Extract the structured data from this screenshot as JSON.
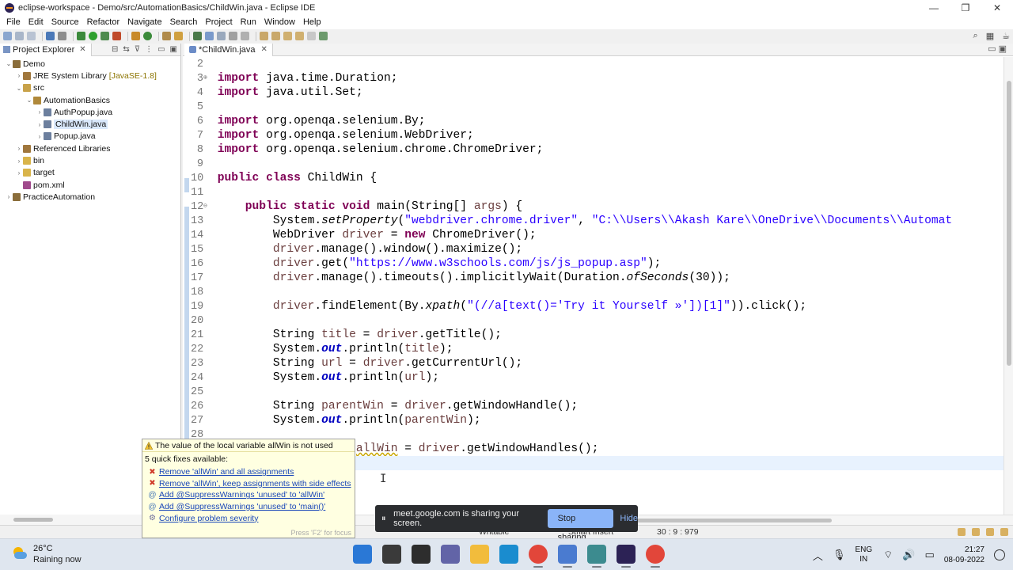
{
  "window": {
    "title": "eclipse-workspace - Demo/src/AutomationBasics/ChildWin.java - Eclipse IDE",
    "min_glyph": "—",
    "max_glyph": "❐",
    "close_glyph": "✕"
  },
  "menu": [
    "File",
    "Edit",
    "Source",
    "Refactor",
    "Navigate",
    "Search",
    "Project",
    "Run",
    "Window",
    "Help"
  ],
  "toolbar": {
    "search_glyph": "⌕",
    "perspective_glyph": "▦",
    "java_perspective_glyph": "☕"
  },
  "explorer": {
    "tab_label": "Project Explorer",
    "close_glyph": "✕",
    "tree": [
      {
        "label": "Demo",
        "indent": 0,
        "chev": "⌄",
        "icon": "project-icon",
        "color": "#8a6d3b"
      },
      {
        "label": "JRE System Library",
        "suffix": "[JavaSE-1.8]",
        "indent": 1,
        "chev": "›",
        "icon": "library-icon",
        "color": "#a0773d"
      },
      {
        "label": "src",
        "indent": 1,
        "chev": "⌄",
        "icon": "source-folder-icon",
        "color": "#c8a24a"
      },
      {
        "label": "AutomationBasics",
        "indent": 2,
        "chev": "⌄",
        "icon": "package-icon",
        "color": "#b0893a"
      },
      {
        "label": "AuthPopup.java",
        "indent": 3,
        "chev": "›",
        "icon": "java-file-icon",
        "color": "#6c7f9e"
      },
      {
        "label": "ChildWin.java",
        "indent": 3,
        "chev": "›",
        "icon": "java-file-icon",
        "color": "#6c7f9e",
        "selected": true
      },
      {
        "label": "Popup.java",
        "indent": 3,
        "chev": "›",
        "icon": "java-file-icon",
        "color": "#6c7f9e"
      },
      {
        "label": "Referenced Libraries",
        "indent": 1,
        "chev": "›",
        "icon": "library-icon",
        "color": "#a0773d"
      },
      {
        "label": "bin",
        "indent": 1,
        "chev": "›",
        "icon": "folder-icon",
        "color": "#d9b44a"
      },
      {
        "label": "target",
        "indent": 1,
        "chev": "›",
        "icon": "folder-icon",
        "color": "#d9b44a"
      },
      {
        "label": "pom.xml",
        "indent": 1,
        "chev": "",
        "icon": "xml-file-icon",
        "color": "#a04a8c"
      },
      {
        "label": "PracticeAutomation",
        "indent": 0,
        "chev": "›",
        "icon": "project-icon",
        "color": "#8a6d3b"
      }
    ]
  },
  "editor": {
    "tab_label": "*ChildWin.java",
    "close_glyph": "✕",
    "minimize_glyph": "▭",
    "maximize_glyph": "▣",
    "current_line": 30,
    "lines": [
      {
        "n": "2",
        "fold": "",
        "html": ""
      },
      {
        "n": "3",
        "fold": "⊕",
        "html": "<span class=\"kw\">import</span> java.time.Duration;"
      },
      {
        "n": "4",
        "fold": "",
        "html": "<span class=\"kw\">import</span> java.util.Set;"
      },
      {
        "n": "5",
        "fold": "",
        "html": ""
      },
      {
        "n": "6",
        "fold": "",
        "html": "<span class=\"kw\">import</span> org.openqa.selenium.By;"
      },
      {
        "n": "7",
        "fold": "",
        "html": "<span class=\"kw\">import</span> org.openqa.selenium.WebDriver;"
      },
      {
        "n": "8",
        "fold": "",
        "html": "<span class=\"kw\">import</span> org.openqa.selenium.chrome.ChromeDriver;"
      },
      {
        "n": "9",
        "fold": "",
        "html": ""
      },
      {
        "n": "10",
        "fold": "",
        "html": "<span class=\"kw\">public class</span> ChildWin {"
      },
      {
        "n": "11",
        "fold": "",
        "html": ""
      },
      {
        "n": "12",
        "fold": "⊖",
        "html": "    <span class=\"kw\">public static void</span> main(String[] <span class=\"var\">args</span>) {"
      },
      {
        "n": "13",
        "fold": "",
        "html": "        System.<span class=\"smt\">setProperty</span>(<span class=\"str\">\"webdriver.chrome.driver\"</span>, <span class=\"str\">\"C:\\\\Users\\\\Akash Kare\\\\OneDrive\\\\Documents\\\\Automat</span>"
      },
      {
        "n": "14",
        "fold": "",
        "html": "        WebDriver <span class=\"var\">driver</span> = <span class=\"kw\">new</span> ChromeDriver();"
      },
      {
        "n": "15",
        "fold": "",
        "html": "        <span class=\"var\">driver</span>.manage().window().maximize();"
      },
      {
        "n": "16",
        "fold": "",
        "html": "        <span class=\"var\">driver</span>.get(<span class=\"str\">\"https://www.w3schools.com/js/js_popup.asp\"</span>);"
      },
      {
        "n": "17",
        "fold": "",
        "html": "        <span class=\"var\">driver</span>.manage().timeouts().implicitlyWait(Duration.<span class=\"smt\">ofSeconds</span>(30));"
      },
      {
        "n": "18",
        "fold": "",
        "html": ""
      },
      {
        "n": "19",
        "fold": "",
        "html": "        <span class=\"var\">driver</span>.findElement(By.<span class=\"smt\">xpath</span>(<span class=\"str\">\"(//a[text()='Try it Yourself »'])[1]\"</span>)).click();"
      },
      {
        "n": "20",
        "fold": "",
        "html": ""
      },
      {
        "n": "21",
        "fold": "",
        "html": "        String <span class=\"var\">title</span> = <span class=\"var\">driver</span>.getTitle();"
      },
      {
        "n": "22",
        "fold": "",
        "html": "        System.<span class=\"fld\">out</span>.println(<span class=\"var\">title</span>);"
      },
      {
        "n": "23",
        "fold": "",
        "html": "        String <span class=\"var\">url</span> = <span class=\"var\">driver</span>.getCurrentUrl();"
      },
      {
        "n": "24",
        "fold": "",
        "html": "        System.<span class=\"fld\">out</span>.println(<span class=\"var\">url</span>);"
      },
      {
        "n": "25",
        "fold": "",
        "html": ""
      },
      {
        "n": "26",
        "fold": "",
        "html": "        String <span class=\"var\">parentWin</span> = <span class=\"var\">driver</span>.getWindowHandle();"
      },
      {
        "n": "27",
        "fold": "",
        "html": "        System.<span class=\"fld\">out</span>.println(<span class=\"var\">parentWin</span>);"
      },
      {
        "n": "28",
        "fold": "",
        "html": ""
      },
      {
        "n": "29",
        "fold": "",
        "html": "        Set&lt;String&gt; <span class=\"warnvar\">allWin</span> = <span class=\"var\">driver</span>.getWindowHandles();"
      },
      {
        "n": "30",
        "fold": "",
        "html": ""
      }
    ]
  },
  "quickfix": {
    "title": "The value of the local variable allWin is not used",
    "subtitle": "5 quick fixes available:",
    "items": [
      {
        "label": "Remove 'allWin' and all assignments",
        "icon": "remove-icon",
        "glyph": "✖",
        "color": "#d03a2a"
      },
      {
        "label": "Remove 'allWin', keep assignments with side effects",
        "icon": "remove-icon",
        "glyph": "✖",
        "color": "#d03a2a"
      },
      {
        "label": "Add @SuppressWarnings 'unused' to 'allWin'",
        "icon": "annotation-icon",
        "glyph": "@",
        "color": "#4a7ab8"
      },
      {
        "label": "Add @SuppressWarnings 'unused' to 'main()'",
        "icon": "annotation-icon",
        "glyph": "@",
        "color": "#4a7ab8"
      },
      {
        "label": "Configure problem severity",
        "icon": "settings-icon",
        "glyph": "⚙",
        "color": "#6a6a9a"
      }
    ],
    "footer": "Press 'F2' for focus"
  },
  "statusbar": {
    "writable": "Writable",
    "insert_mode": "Smart Insert",
    "position": "30 : 9 : 979"
  },
  "sharebar": {
    "message": "meet.google.com is sharing your screen.",
    "stop_label": "Stop sharing",
    "hide_label": "Hide",
    "pause_glyph": "⏸"
  },
  "taskbar": {
    "temperature": "26°C",
    "weather": "Raining now",
    "lang_line1": "ENG",
    "lang_line2": "IN",
    "time": "21:27",
    "date": "08-09-2022",
    "apps": [
      {
        "name": "windows-start-icon",
        "color": "#2a78d6"
      },
      {
        "name": "search-icon",
        "color": "#3a3a3a"
      },
      {
        "name": "task-view-icon",
        "color": "#2d2d2d"
      },
      {
        "name": "teams-chat-icon",
        "color": "#6264a7"
      },
      {
        "name": "file-explorer-icon",
        "color": "#f2bc3c"
      },
      {
        "name": "edge-icon",
        "color": "#1a8ccf"
      },
      {
        "name": "chrome-icon",
        "color": "#e2463a"
      },
      {
        "name": "notepad-icon",
        "color": "#4a7bd0"
      },
      {
        "name": "globe-app-icon",
        "color": "#3c8b8f"
      },
      {
        "name": "eclipse-icon",
        "color": "#2c2255"
      },
      {
        "name": "chrome-icon",
        "color": "#e2463a"
      }
    ],
    "tray": [
      {
        "name": "chevron-up-icon",
        "glyph": "︿"
      },
      {
        "name": "microphone-icon",
        "glyph": "🎙"
      }
    ],
    "tray_right": [
      {
        "name": "wifi-icon",
        "glyph": "⌔"
      },
      {
        "name": "speaker-icon",
        "glyph": "🔊"
      },
      {
        "name": "battery-icon",
        "glyph": "▭"
      }
    ]
  }
}
